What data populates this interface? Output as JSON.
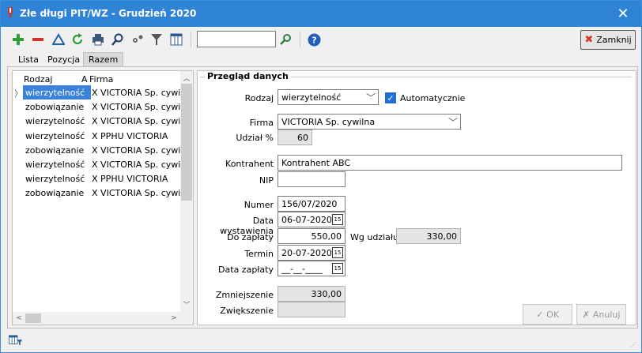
{
  "window": {
    "title": "Złe długi PIT/WZ - Grudzień 2020"
  },
  "toolbar": {
    "close_label": "Zamknij",
    "search_value": "",
    "icons": [
      "add-icon",
      "delete-icon",
      "edit-icon",
      "refresh-icon",
      "print-icon",
      "search-icon",
      "settings-icon",
      "filter-icon",
      "columns-icon",
      "search-go-icon",
      "help-icon"
    ]
  },
  "tabs": [
    {
      "label": "Lista"
    },
    {
      "label": "Pozycja"
    },
    {
      "label": "Razem"
    }
  ],
  "list": {
    "columns": {
      "rodzaj": "Rodzaj",
      "a": "A",
      "firma": "Firma"
    },
    "rows": [
      {
        "rodzaj": "wierzytelność",
        "a": "X",
        "firma": "VICTORIA Sp. cywilna",
        "selected": true
      },
      {
        "rodzaj": "zobowiązanie",
        "a": "X",
        "firma": "VICTORIA Sp. cywilna"
      },
      {
        "rodzaj": "wierzytelność",
        "a": "X",
        "firma": "VICTORIA Sp. cywilna"
      },
      {
        "rodzaj": "wierzytelność",
        "a": "X",
        "firma": "PPHU VICTORIA"
      },
      {
        "rodzaj": "zobowiązanie",
        "a": "X",
        "firma": "VICTORIA Sp. cywilna"
      },
      {
        "rodzaj": "wierzytelność",
        "a": "X",
        "firma": "VICTORIA Sp. cywilna"
      },
      {
        "rodzaj": "wierzytelność",
        "a": "X",
        "firma": "PPHU VICTORIA"
      },
      {
        "rodzaj": "zobowiązanie",
        "a": "X",
        "firma": "VICTORIA Sp. cywilna"
      }
    ]
  },
  "form": {
    "group_title": "Przegląd danych",
    "rodzaj_label": "Rodzaj",
    "rodzaj_value": "wierzytelność",
    "auto_label": "Automatycznie",
    "auto_checked": true,
    "firma_label": "Firma",
    "firma_value": "VICTORIA Sp. cywilna",
    "udzial_label": "Udział %",
    "udzial_value": "60",
    "kontrahent_label": "Kontrahent",
    "kontrahent_value": "Kontrahent ABC",
    "nip_label": "NIP",
    "nip_value": "",
    "numer_label": "Numer",
    "numer_value": "156/07/2020",
    "data_wyst_label": "Data wystawienia",
    "data_wyst_value": "06-07-2020",
    "do_zaplaty_label": "Do zapłaty",
    "do_zaplaty_value": "550,00",
    "wg_udzialu_label": "Wg udziału",
    "wg_udzialu_value": "330,00",
    "termin_label": "Termin",
    "termin_value": "20-07-2020",
    "data_zaplaty_label": "Data zapłaty",
    "data_zaplaty_value": "__-__-____",
    "zmniejszenie_label": "Zmniejszenie",
    "zmniejszenie_value": "330,00",
    "zwiekszenie_label": "Zwiększenie",
    "zwiekszenie_value": "",
    "ok_label": "OK",
    "cancel_label": "Anuluj"
  }
}
